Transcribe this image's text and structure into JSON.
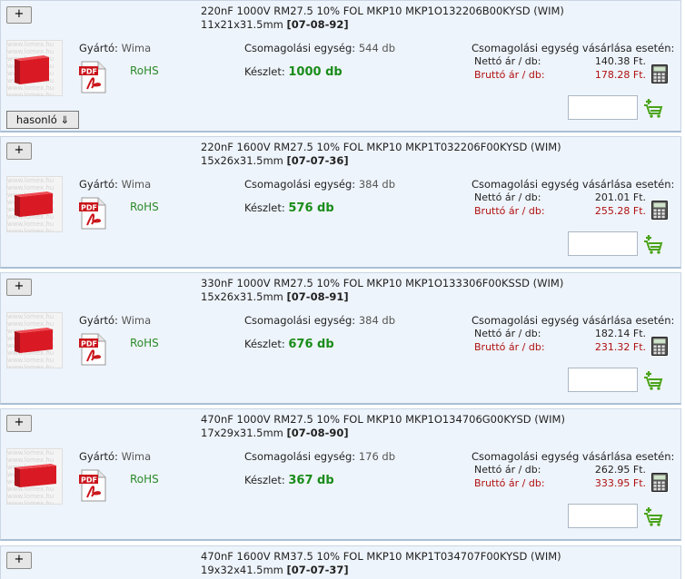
{
  "labels": {
    "expand": "+",
    "manufacturer": "Gyártó:",
    "rohs": "RoHS",
    "pack_unit": "Csomagolási egység:",
    "stock": "Készlet:",
    "price_header": "Csomagolási egység vásárlása esetén:",
    "net_price": "Nettó ár / db:",
    "gross_price": "Bruttó ár / db:",
    "similar": "hasonló ⇓"
  },
  "colors": {
    "stock_green": "#1a8c1a",
    "gross_red": "#b01010",
    "rohs_green": "#2b8a2b",
    "card_bg": "#eef4fb"
  },
  "products": [
    {
      "title": "220nF 1000V RM27.5 10% FOL MKP10 MKP1O132206B00KYSD (WIM)",
      "dims": "11x21x31.5mm",
      "code": "[07-08-92]",
      "manufacturer": "Wima",
      "pack_unit": "544 db",
      "stock": "1000 db",
      "net": "140.38 Ft.",
      "gross": "178.28 Ft.",
      "has_similar": true,
      "thumb_icon": "capacitor-image"
    },
    {
      "title": "220nF 1600V RM27.5 10% FOL MKP10 MKP1T032206F00KYSD (WIM)",
      "dims": "15x26x31.5mm",
      "code": "[07-07-36]",
      "manufacturer": "Wima",
      "pack_unit": "384 db",
      "stock": "576 db",
      "net": "201.01 Ft.",
      "gross": "255.28 Ft.",
      "has_similar": false,
      "thumb_icon": "capacitor-image"
    },
    {
      "title": "330nF 1000V RM27.5 10% FOL MKP10 MKP1O133306F00KSSD (WIM)",
      "dims": "15x26x31.5mm",
      "code": "[07-08-91]",
      "manufacturer": "Wima",
      "pack_unit": "384 db",
      "stock": "676 db",
      "net": "182.14 Ft.",
      "gross": "231.32 Ft.",
      "has_similar": false,
      "thumb_icon": "capacitor-image"
    },
    {
      "title": "470nF 1000V RM27.5 10% FOL MKP10 MKP1O134706G00KYSD (WIM)",
      "dims": "17x29x31.5mm",
      "code": "[07-08-90]",
      "manufacturer": "Wima",
      "pack_unit": "176 db",
      "stock": "367 db",
      "net": "262.95 Ft.",
      "gross": "333.95 Ft.",
      "has_similar": false,
      "thumb_icon": "capacitor-image"
    }
  ],
  "partial": {
    "title": "470nF 1600V RM37.5 10% FOL MKP10 MKP1T034707F00KYSD (WIM)",
    "dims": "19x32x41.5mm",
    "code": "[07-07-37]"
  },
  "watermark": "www.lomex.hu"
}
